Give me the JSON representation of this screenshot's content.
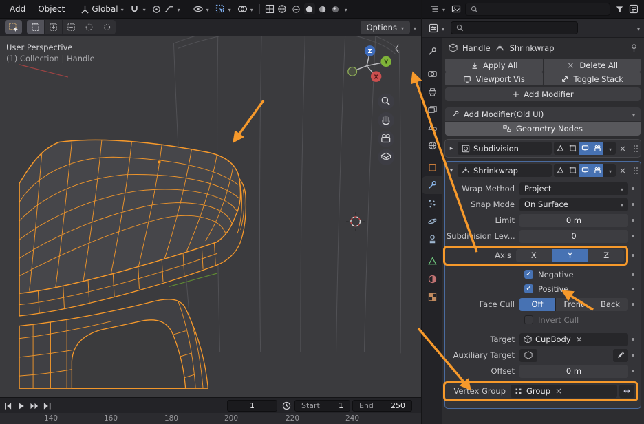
{
  "colors": {
    "accent_blue": "#4772b3",
    "selection_orange": "#f6992b",
    "annotation_orange": "#f6992b",
    "axis_x": "#cc4f4f",
    "axis_y": "#7fb439",
    "axis_z": "#3f6dbd"
  },
  "icons": {
    "chevron-down-icon": "▾",
    "expand-right-icon": "▸",
    "close-icon": "×",
    "check-icon": "✓",
    "plus-icon": "+",
    "swap-icon": "↔",
    "collapse-icon": "‹",
    "animate-dot-icon": "•"
  },
  "topbar": {
    "menu_add": "Add",
    "menu_object": "Object",
    "orientation": "Global",
    "options_button": "Options"
  },
  "viewport": {
    "perspective": "User Perspective",
    "collection": "(1) Collection | Handle",
    "gizmo_x": "X",
    "gizmo_y": "Y",
    "gizmo_z": "Z"
  },
  "timeline": {
    "frame": "1",
    "start_label": "Start",
    "start_value": "1",
    "end_label": "End",
    "end_value": "250",
    "ticks": [
      "140",
      "160",
      "180",
      "200",
      "220",
      "240"
    ]
  },
  "properties": {
    "breadcrumb_object": "Handle",
    "breadcrumb_modifier": "Shrinkwrap",
    "apply_all": "Apply All",
    "delete_all": "Delete All",
    "viewport_vis": "Viewport Vis",
    "toggle_stack": "Toggle Stack",
    "add_modifier": "Add Modifier",
    "add_modifier_old": "Add Modifier(Old UI)",
    "geometry_nodes": "Geometry Nodes",
    "modifier_subdivision": "Subdivision",
    "modifier_shrinkwrap": "Shrinkwrap",
    "rows": {
      "wrap_method": {
        "label": "Wrap Method",
        "value": "Project"
      },
      "snap_mode": {
        "label": "Snap Mode",
        "value": "On Surface"
      },
      "limit": {
        "label": "Limit",
        "value": "0 m"
      },
      "subdivision_levels": {
        "label": "Subdivision Lev...",
        "value": "0"
      },
      "axis": {
        "label": "Axis",
        "options": [
          "X",
          "Y",
          "Z"
        ],
        "active": "Y"
      },
      "negative": {
        "label": "Negative",
        "checked": true
      },
      "positive": {
        "label": "Positive",
        "checked": true
      },
      "face_cull": {
        "label": "Face Cull",
        "options": [
          "Off",
          "Front",
          "Back"
        ],
        "active": "Off"
      },
      "invert_cull": {
        "label": "Invert Cull",
        "checked": false
      },
      "target": {
        "label": "Target",
        "value": "CupBody"
      },
      "auxiliary_target": {
        "label": "Auxiliary Target",
        "value": ""
      },
      "offset": {
        "label": "Offset",
        "value": "0 m"
      },
      "vertex_group": {
        "label": "Vertex Group",
        "value": "Group"
      }
    }
  }
}
